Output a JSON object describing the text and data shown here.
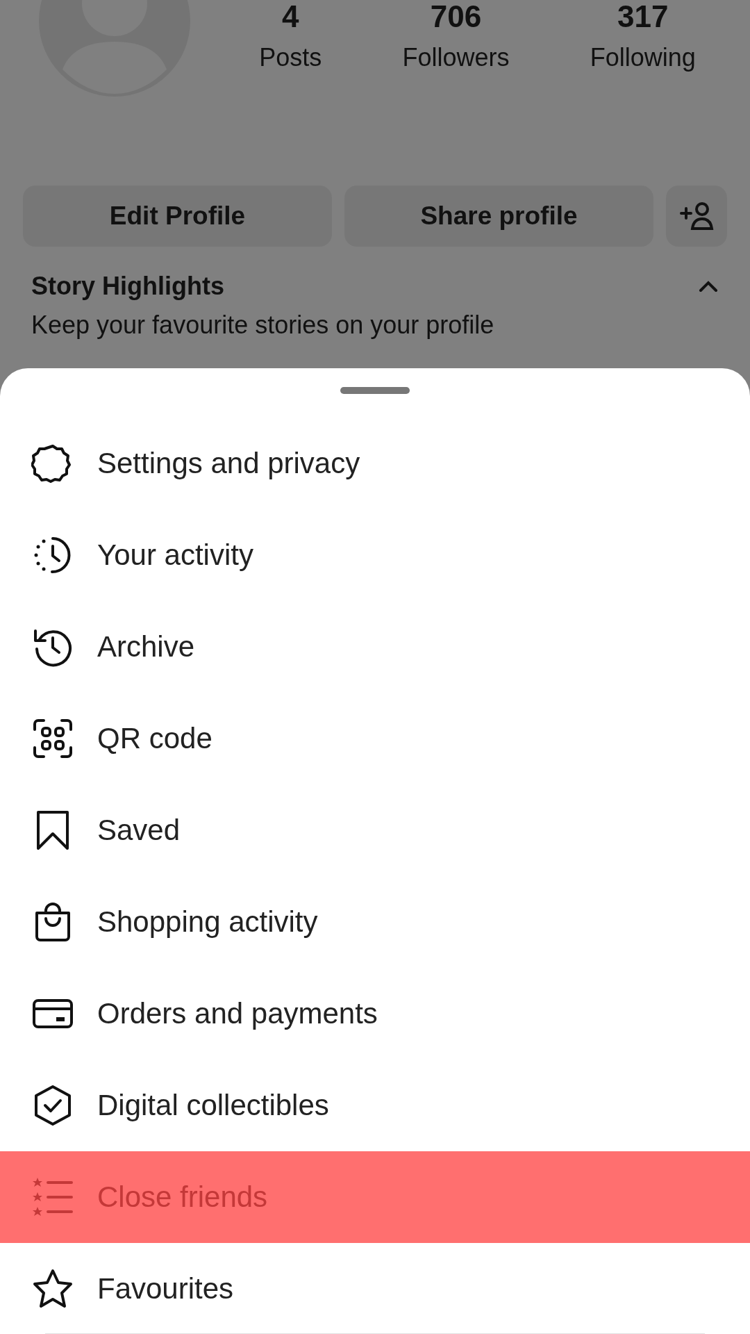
{
  "profile": {
    "stats": [
      {
        "count": "4",
        "label": "Posts"
      },
      {
        "count": "706",
        "label": "Followers"
      },
      {
        "count": "317",
        "label": "Following"
      }
    ],
    "buttons": [
      "Edit Profile",
      "Share profile"
    ],
    "highlights": {
      "title": "Story Highlights",
      "subtitle": "Keep your favourite stories on your profile",
      "expanded": true
    }
  },
  "menu": {
    "items": [
      {
        "label": "Settings and privacy",
        "selected": false
      },
      {
        "label": "Your activity",
        "selected": false
      },
      {
        "label": "Archive",
        "selected": false
      },
      {
        "label": "QR code",
        "selected": false
      },
      {
        "label": "Saved",
        "selected": false
      },
      {
        "label": "Shopping activity",
        "selected": false
      },
      {
        "label": "Orders and payments",
        "selected": false
      },
      {
        "label": "Digital collectibles",
        "selected": false
      },
      {
        "label": "Close friends",
        "selected": true
      },
      {
        "label": "Favourites",
        "selected": false
      }
    ]
  }
}
